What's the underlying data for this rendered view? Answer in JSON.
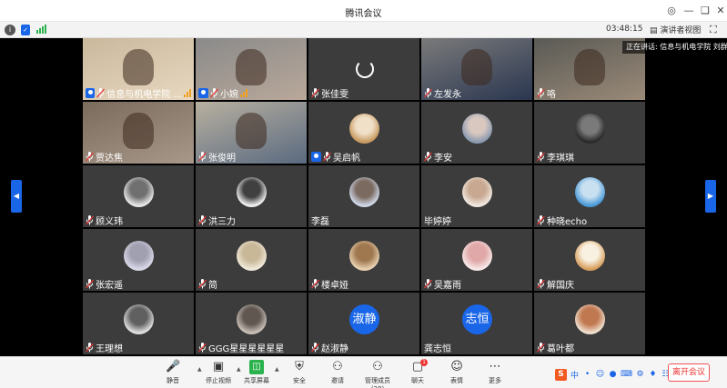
{
  "window": {
    "title": "腾讯会议"
  },
  "infobar": {
    "timer": "03:48:15",
    "speaker_view": "演讲者视图"
  },
  "speaking_banner": "正在讲话: 信息与机电学院 刘群",
  "participants": [
    {
      "name": "信息与机电学院 ...",
      "host": true,
      "signal": true,
      "kind": "cam",
      "colors": [
        "#c9b89c",
        "#e8d8c0"
      ]
    },
    {
      "name": "小婉",
      "host": true,
      "signal": true,
      "kind": "cam",
      "colors": [
        "#8a8a8a",
        "#b9a89a"
      ]
    },
    {
      "name": "张佳雯",
      "kind": "loading"
    },
    {
      "name": "左发永",
      "kind": "cam",
      "colors": [
        "#7a7a7a",
        "#2a3650"
      ]
    },
    {
      "name": "咯",
      "kind": "cam",
      "colors": [
        "#5a5a55",
        "#9a8a78"
      ]
    },
    {
      "name": "贾达焦",
      "kind": "cam",
      "colors": [
        "#7b6b5c",
        "#a8988a"
      ]
    },
    {
      "name": "张俊明",
      "kind": "cam",
      "colors": [
        "#b8b0a0",
        "#5a6a80"
      ]
    },
    {
      "name": "吴启帆",
      "host": true,
      "kind": "avatar",
      "colors": [
        "#c89a60",
        "#f0e0c8"
      ]
    },
    {
      "name": "李安",
      "kind": "avatar",
      "colors": [
        "#8a9ab0",
        "#d8c8c0"
      ]
    },
    {
      "name": "李琪琪",
      "kind": "avatar",
      "colors": [
        "#2a2a2a",
        "#7a7a7a"
      ]
    },
    {
      "name": "顾义玮",
      "kind": "avatar",
      "colors": [
        "#e8e8e8",
        "#707070"
      ]
    },
    {
      "name": "洪三力",
      "kind": "avatar",
      "colors": [
        "#f0f0f0",
        "#404040"
      ]
    },
    {
      "name": "李磊",
      "kind": "avatar",
      "nomic": true,
      "colors": [
        "#d0d8e8",
        "#7a6a60"
      ]
    },
    {
      "name": "毕婷婷",
      "kind": "avatar",
      "nomic": true,
      "colors": [
        "#f0e8e0",
        "#c8a890"
      ]
    },
    {
      "name": "种晓echo",
      "kind": "avatar",
      "colors": [
        "#4a9ad8",
        "#c8e0f0"
      ]
    },
    {
      "name": "张宏遥",
      "kind": "avatar",
      "colors": [
        "#d8d8e8",
        "#a0a0b0"
      ]
    },
    {
      "name": "简",
      "kind": "avatar",
      "colors": [
        "#f0e8d8",
        "#c8b898"
      ]
    },
    {
      "name": "楼卓娅",
      "kind": "avatar",
      "colors": [
        "#e8d0b0",
        "#a07850"
      ]
    },
    {
      "name": "吴嘉雨",
      "kind": "avatar",
      "colors": [
        "#f8e8e8",
        "#e0a8a8"
      ]
    },
    {
      "name": "解国庆",
      "kind": "avatar",
      "colors": [
        "#d8a060",
        "#f8f0e0"
      ]
    },
    {
      "name": "王理想",
      "kind": "avatar",
      "colors": [
        "#e0e0e0",
        "#606060"
      ]
    },
    {
      "name": "GGG星星星星星星",
      "kind": "avatar",
      "colors": [
        "#c8c0b8",
        "#605850"
      ]
    },
    {
      "name": "赵淑静",
      "kind": "text",
      "text": "淑静"
    },
    {
      "name": "龚志恒",
      "kind": "text",
      "text": "志恒",
      "nomic": true
    },
    {
      "name": "葛叶都",
      "kind": "avatar",
      "colors": [
        "#f0e0d0",
        "#c07850"
      ]
    }
  ],
  "toolbar": {
    "items": [
      {
        "label": "静音",
        "icon": "mic-icon"
      },
      {
        "label": "停止视频",
        "icon": "camera-icon"
      },
      {
        "label": "共享屏幕",
        "icon": "share-screen-icon"
      },
      {
        "label": "安全",
        "icon": "shield-icon"
      },
      {
        "label": "邀请",
        "icon": "invite-icon"
      },
      {
        "label": "管理成员(28)",
        "icon": "members-icon"
      },
      {
        "label": "聊天",
        "icon": "chat-icon"
      },
      {
        "label": "表情",
        "icon": "emoji-icon"
      },
      {
        "label": "更多",
        "icon": "more-icon"
      }
    ],
    "chat_badge": "1",
    "leave": "离开会议"
  },
  "ime": {
    "brand": "S",
    "lang": "中"
  },
  "colors": {
    "accent": "#1a66e8",
    "danger": "#e33333",
    "tile": "#3c3c3c"
  }
}
